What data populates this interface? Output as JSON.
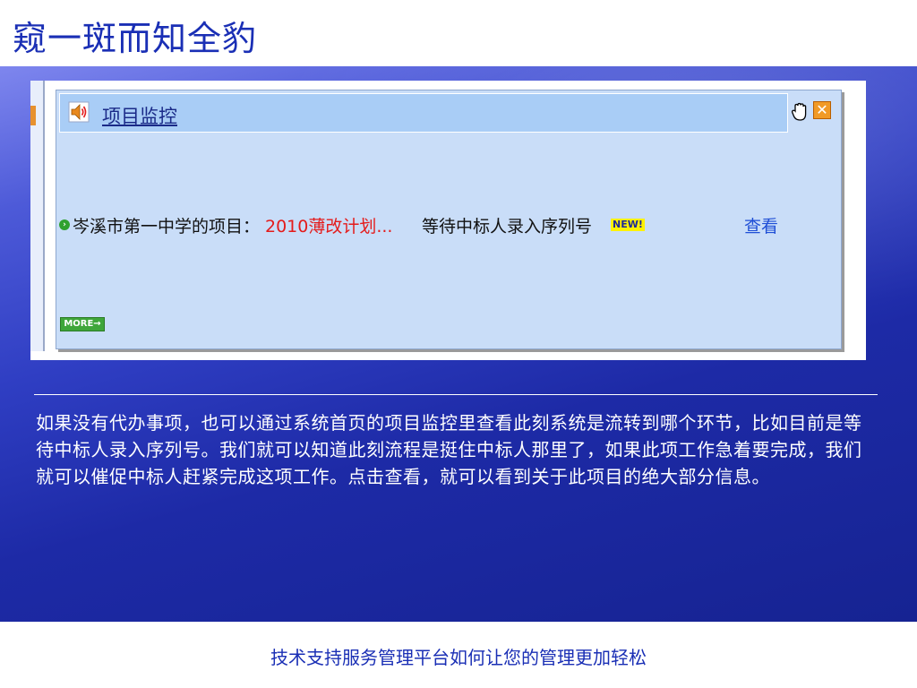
{
  "slide": {
    "title": "窥一斑而知全豹",
    "footer": "技术支持服务管理平台如何让您的管理更加轻松"
  },
  "module": {
    "title": "项目监控",
    "close_symbol": "✕",
    "more_label": "MORE→",
    "icons": {
      "header": "speaker-icon",
      "drag": "hand-icon",
      "close": "close-icon",
      "bullet": "arrow-bullet-icon"
    }
  },
  "project_row": {
    "school": "岑溪市第一中学的项目：",
    "project_name": "2010薄改计划...",
    "status": "等待中标人录入序列号",
    "badge": "NEW!",
    "link": "查看"
  },
  "description": "如果没有代办事项，也可以通过系统首页的项目监控里查看此刻系统是流转到哪个环节，比如目前是等待中标人录入序列号。我们就可以知道此刻流程是挺住中标人那里了，如果此项工作急着要完成，我们就可以催促中标人赶紧完成这项工作。点击查看，就可以看到关于此项目的绝大部分信息。",
  "colors": {
    "title": "#1a2fb5",
    "project_name": "#e41b1b",
    "link": "#1f4fd6",
    "badge": "#fff200",
    "panel": "#c9ddf8"
  }
}
